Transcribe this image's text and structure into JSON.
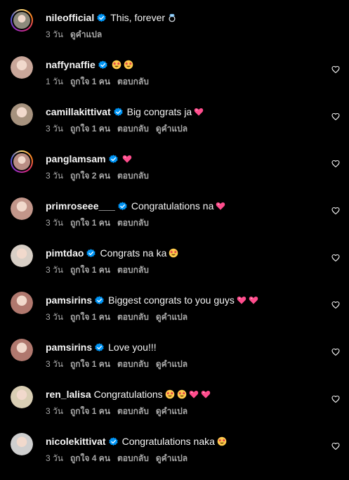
{
  "colors": {
    "background": "#000000",
    "text": "#f5f5f5",
    "meta": "#a8a8a8",
    "verified": "#0095f6",
    "heart_emoji": "#ff4d8d"
  },
  "comments": [
    {
      "username": "nileofficial",
      "verified": true,
      "story_ring": true,
      "avatar_color": "#8d8a7c",
      "text": "This, forever",
      "emojis": [
        "ring-emoji"
      ],
      "time": "3 วัน",
      "likes": "",
      "reply": "",
      "translate": "ดูคำแปล",
      "show_like": false
    },
    {
      "username": "naffynaffie",
      "verified": true,
      "story_ring": false,
      "avatar_color": "#c9a79a",
      "text": "",
      "emojis": [
        "star-struck-emoji",
        "star-struck-emoji"
      ],
      "time": "1 วัน",
      "likes": "ถูกใจ 1 คน",
      "reply": "ตอบกลับ",
      "translate": "",
      "show_like": true
    },
    {
      "username": "camillakittivat",
      "verified": true,
      "story_ring": false,
      "avatar_color": "#a6927e",
      "text": "Big congrats ja",
      "emojis": [
        "pink-heart-emoji"
      ],
      "time": "3 วัน",
      "likes": "ถูกใจ 1 คน",
      "reply": "ตอบกลับ",
      "translate": "ดูคำแปล",
      "show_like": true
    },
    {
      "username": "panglamsam",
      "verified": true,
      "story_ring": true,
      "avatar_color": "#b98d84",
      "text": "",
      "emojis": [
        "pink-heart-emoji"
      ],
      "time": "3 วัน",
      "likes": "ถูกใจ 2 คน",
      "reply": "ตอบกลับ",
      "translate": "",
      "show_like": true
    },
    {
      "username": "primroseee___",
      "verified": true,
      "story_ring": false,
      "avatar_color": "#c2968a",
      "text": "Congratulations na",
      "emojis": [
        "pink-heart-emoji"
      ],
      "time": "3 วัน",
      "likes": "ถูกใจ 1 คน",
      "reply": "ตอบกลับ",
      "translate": "",
      "show_like": true
    },
    {
      "username": "pimtdao",
      "verified": true,
      "story_ring": false,
      "avatar_color": "#d8cfc6",
      "text": "Congrats na ka",
      "emojis": [
        "star-struck-emoji"
      ],
      "time": "3 วัน",
      "likes": "ถูกใจ 1 คน",
      "reply": "ตอบกลับ",
      "translate": "",
      "show_like": true
    },
    {
      "username": "pamsirins",
      "verified": true,
      "story_ring": false,
      "avatar_color": "#b0786e",
      "text": "Biggest congrats to you guys",
      "emojis": [
        "pink-heart-emoji",
        "pink-heart-emoji"
      ],
      "time": "3 วัน",
      "likes": "ถูกใจ 1 คน",
      "reply": "ตอบกลับ",
      "translate": "ดูคำแปล",
      "show_like": true
    },
    {
      "username": "pamsirins",
      "verified": true,
      "story_ring": false,
      "avatar_color": "#b0786e",
      "text": "Love you!!!",
      "emojis": [],
      "time": "3 วัน",
      "likes": "ถูกใจ 1 คน",
      "reply": "ตอบกลับ",
      "translate": "ดูคำแปล",
      "show_like": true
    },
    {
      "username": "ren_lalisa",
      "verified": false,
      "story_ring": false,
      "avatar_color": "#d9ceb4",
      "text": "Congratulations",
      "emojis": [
        "star-struck-emoji",
        "star-struck-emoji",
        "pink-heart-emoji",
        "pink-heart-emoji"
      ],
      "time": "3 วัน",
      "likes": "ถูกใจ 1 คน",
      "reply": "ตอบกลับ",
      "translate": "ดูคำแปล",
      "show_like": true
    },
    {
      "username": "nicolekittivat",
      "verified": true,
      "story_ring": false,
      "avatar_color": "#cfcfcf",
      "text": "Congratulations naka",
      "emojis": [
        "star-struck-emoji"
      ],
      "time": "3 วัน",
      "likes": "ถูกใจ 4 คน",
      "reply": "ตอบกลับ",
      "translate": "ดูคำแปล",
      "show_like": true
    }
  ]
}
